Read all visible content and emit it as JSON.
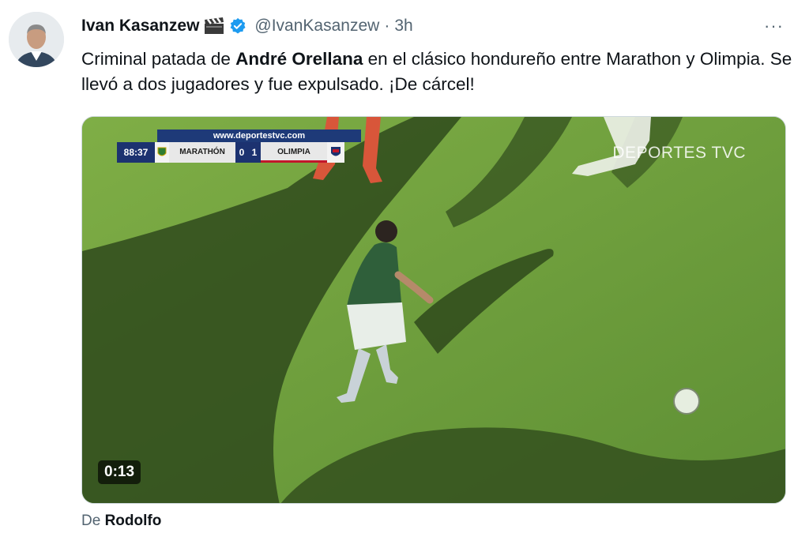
{
  "tweet": {
    "display_name": "Ivan Kasanzew",
    "handle": "@IvanKasanzew",
    "separator": "·",
    "time": "3h",
    "more_label": "···",
    "text_part1": "Criminal patada de ",
    "text_bold": "André Orellana",
    "text_part2": " en el clásico hondureño entre Marathon y Olimpia. Se llevó a dos jugadores y fue expulsado. ¡De cárcel!"
  },
  "video": {
    "duration": "0:13",
    "watermark": "DEPORTES TVC",
    "scoreboard": {
      "url": "www.deportestvc.com",
      "clock": "88:37",
      "home_team": "MARATHÓN",
      "home_score": "0",
      "away_score": "1",
      "away_team": "OLIMPIA"
    }
  },
  "attribution": {
    "prefix": "De",
    "source": "Rodolfo"
  },
  "icons": [
    "clapperboard-emoji",
    "verified-badge-icon",
    "more-options-icon"
  ],
  "colors": {
    "verified": "#1d9bf0",
    "secondary_text": "#536471",
    "primary_text": "#0f1419"
  }
}
